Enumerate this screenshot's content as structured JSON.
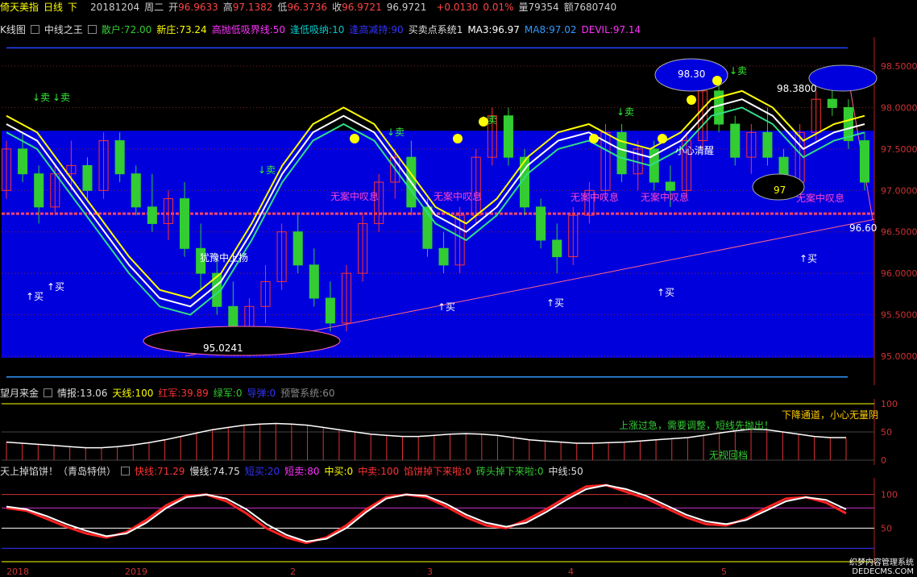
{
  "topbar": {
    "name": "倚天美指",
    "period": "日线",
    "direction": "下",
    "date": "20181204",
    "weekday": "周二",
    "open_label": "开",
    "open": "96.9633",
    "high_label": "高",
    "high": "97.1382",
    "low_label": "低",
    "low": "96.3736",
    "close_label": "收",
    "close": "96.9721",
    "last": "96.9721",
    "change": "+0.0130",
    "change_pct": "0.01%",
    "volume_label": "量",
    "volume": "79354",
    "amount_label": "额",
    "amount": "7680740"
  },
  "main_header": {
    "kline_label": "K线图",
    "indicator_name": "中线之王",
    "items": [
      {
        "text": "散户:72.00",
        "color": "#33cc33"
      },
      {
        "text": "新庄:73.24",
        "color": "#ffff00"
      },
      {
        "text": "高抛低吸界线:50",
        "color": "#ff33ff"
      },
      {
        "text": "逢低吸纳:10",
        "color": "#00cccc"
      },
      {
        "text": "逢高减持:90",
        "color": "#3333ff"
      },
      {
        "text": "买卖点系统1",
        "color": "#dddddd"
      },
      {
        "text": "MA3:96.97",
        "color": "#ffffff"
      },
      {
        "text": "MA8:97.02",
        "color": "#3399ff"
      },
      {
        "text": "DEVIL:97.14",
        "color": "#ff33ff"
      }
    ]
  },
  "ind1_header": {
    "name": "望月来金",
    "items": [
      {
        "text": "情报:13.06",
        "color": "#dddddd"
      },
      {
        "text": "天线:100",
        "color": "#ffff00"
      },
      {
        "text": "红军:39.89",
        "color": "#ff3333"
      },
      {
        "text": "绿军:0",
        "color": "#33cc33"
      },
      {
        "text": "导弹:0",
        "color": "#3333ff"
      },
      {
        "text": "预警系统:60",
        "color": "#888888"
      }
    ],
    "annotations": [
      "下降通道，小心无量阴",
      "上涨过急，需要调整，短线先抛出！",
      "无视回档"
    ]
  },
  "ind2_header": {
    "name": "天上掉馅饼！（青岛特供）",
    "items": [
      {
        "text": "快线:71.29",
        "color": "#ff3333"
      },
      {
        "text": "慢线:74.75",
        "color": "#dddddd"
      },
      {
        "text": "短买:20",
        "color": "#3333ff"
      },
      {
        "text": "短卖:80",
        "color": "#ff33ff"
      },
      {
        "text": "中买:0",
        "color": "#ffff00"
      },
      {
        "text": "中卖:100",
        "color": "#ff3333"
      },
      {
        "text": "馅饼掉下来啦:0",
        "color": "#ff3333"
      },
      {
        "text": "砖头掉下来啦:0",
        "color": "#33cc33"
      },
      {
        "text": "中线:50",
        "color": "#dddddd"
      }
    ]
  },
  "annotations": {
    "buy": "↑买",
    "sell": "↓卖",
    "buy_plain": "买",
    "sleep": "无案中叹息",
    "hesitate": "犹豫中上扬",
    "careful": "小心清醒",
    "label_9830": "98.30",
    "label_9838": "98.3800",
    "label_97": "97",
    "label_950241": "95.0241",
    "label_9660": "96.60"
  },
  "xaxis": [
    "2018",
    "2019",
    "2",
    "3",
    "4",
    "5"
  ],
  "watermark": [
    "织梦内容管理系统",
    "DEDECMS.COM"
  ],
  "colors": {
    "channel": "#0000dd",
    "up": "#ff3333",
    "down": "#33cc33",
    "ma_white": "#ffffff",
    "ma_yellow": "#ffff00"
  },
  "chart_data": [
    {
      "type": "candlestick",
      "title": "倚天美指 日线",
      "y_ticks": [
        95.0,
        95.5,
        96.0,
        96.5,
        97.0,
        97.5,
        98.0,
        98.5
      ],
      "ylim": [
        94.65,
        98.85
      ],
      "ohlc": [
        [
          97.0,
          97.6,
          96.9,
          97.5
        ],
        [
          97.5,
          97.7,
          97.1,
          97.2
        ],
        [
          97.2,
          97.3,
          96.6,
          96.8
        ],
        [
          96.8,
          97.3,
          96.7,
          97.2
        ],
        [
          97.2,
          97.6,
          97.0,
          97.3
        ],
        [
          97.3,
          97.4,
          96.9,
          97.0
        ],
        [
          97.0,
          97.7,
          96.9,
          97.6
        ],
        [
          97.6,
          97.7,
          97.1,
          97.2
        ],
        [
          97.2,
          97.3,
          96.7,
          96.8
        ],
        [
          96.8,
          97.2,
          96.5,
          96.6
        ],
        [
          96.6,
          97.0,
          96.4,
          96.9
        ],
        [
          96.9,
          97.1,
          96.2,
          96.3
        ],
        [
          96.3,
          96.6,
          95.8,
          96.0
        ],
        [
          96.0,
          96.2,
          95.5,
          95.6
        ],
        [
          95.6,
          95.9,
          95.1,
          95.2
        ],
        [
          95.2,
          95.7,
          95.0,
          95.6
        ],
        [
          95.6,
          96.1,
          95.4,
          95.9
        ],
        [
          95.9,
          96.6,
          95.8,
          96.5
        ],
        [
          96.5,
          96.7,
          96.0,
          96.1
        ],
        [
          96.1,
          96.3,
          95.6,
          95.7
        ],
        [
          95.7,
          95.9,
          95.3,
          95.4
        ],
        [
          95.4,
          96.1,
          95.3,
          96.0
        ],
        [
          96.0,
          96.7,
          95.9,
          96.6
        ],
        [
          96.6,
          97.2,
          96.5,
          97.1
        ],
        [
          97.1,
          97.5,
          96.9,
          97.4
        ],
        [
          97.4,
          97.6,
          96.7,
          96.8
        ],
        [
          96.8,
          96.9,
          96.2,
          96.3
        ],
        [
          96.3,
          96.5,
          96.0,
          96.1
        ],
        [
          96.1,
          96.8,
          96.0,
          96.7
        ],
        [
          96.7,
          97.5,
          96.6,
          97.4
        ],
        [
          97.4,
          98.0,
          97.3,
          97.9
        ],
        [
          97.9,
          98.0,
          97.3,
          97.4
        ],
        [
          97.4,
          97.5,
          96.7,
          96.8
        ],
        [
          96.8,
          96.9,
          96.3,
          96.4
        ],
        [
          96.4,
          96.6,
          96.0,
          96.2
        ],
        [
          96.2,
          96.8,
          96.1,
          96.7
        ],
        [
          96.7,
          97.1,
          96.6,
          97.0
        ],
        [
          97.0,
          97.8,
          96.9,
          97.7
        ],
        [
          97.7,
          97.8,
          97.1,
          97.2
        ],
        [
          97.2,
          97.6,
          97.0,
          97.5
        ],
        [
          97.5,
          97.6,
          97.0,
          97.1
        ],
        [
          97.1,
          97.3,
          96.8,
          97.0
        ],
        [
          97.0,
          97.7,
          96.9,
          97.6
        ],
        [
          97.6,
          98.4,
          97.5,
          98.2
        ],
        [
          98.2,
          98.4,
          97.7,
          97.8
        ],
        [
          97.8,
          97.9,
          97.3,
          97.4
        ],
        [
          97.4,
          97.8,
          97.2,
          97.7
        ],
        [
          97.7,
          98.0,
          97.3,
          97.4
        ],
        [
          97.4,
          97.5,
          97.0,
          97.1
        ],
        [
          97.1,
          97.8,
          97.0,
          97.7
        ],
        [
          97.7,
          98.2,
          97.6,
          98.1
        ],
        [
          98.1,
          98.4,
          97.9,
          98.0
        ],
        [
          98.0,
          98.1,
          97.5,
          97.6
        ],
        [
          97.6,
          97.7,
          97.0,
          97.1
        ]
      ],
      "ma_white": [
        97.8,
        97.6,
        97.1,
        96.6,
        96.1,
        95.7,
        95.6,
        95.9,
        96.5,
        97.2,
        97.7,
        97.9,
        97.7,
        97.2,
        96.7,
        96.5,
        96.8,
        97.3,
        97.6,
        97.7,
        97.5,
        97.4,
        97.6,
        98.0,
        98.1,
        97.9,
        97.5,
        97.7,
        97.8
      ],
      "ma_yellow": [
        97.9,
        97.7,
        97.2,
        96.7,
        96.2,
        95.8,
        95.7,
        96.0,
        96.6,
        97.3,
        97.8,
        98.0,
        97.8,
        97.3,
        96.8,
        96.6,
        96.9,
        97.4,
        97.7,
        97.8,
        97.6,
        97.5,
        97.7,
        98.1,
        98.2,
        98.0,
        97.6,
        97.8,
        97.9
      ],
      "ma_green": [
        97.7,
        97.5,
        97.0,
        96.5,
        96.0,
        95.6,
        95.5,
        95.8,
        96.4,
        97.1,
        97.6,
        97.8,
        97.6,
        97.1,
        96.6,
        96.4,
        96.7,
        97.2,
        97.5,
        97.6,
        97.4,
        97.3,
        97.5,
        97.9,
        98.0,
        97.8,
        97.4,
        97.6,
        97.7
      ]
    },
    {
      "type": "bar",
      "title": "望月来金",
      "y_ticks": [
        0,
        50,
        100
      ],
      "ylim": [
        0,
        100
      ],
      "values": [
        32,
        30,
        28,
        26,
        24,
        22,
        22,
        24,
        27,
        31,
        36,
        42,
        48,
        54,
        58,
        62,
        64,
        65,
        64,
        62,
        58,
        54,
        50,
        46,
        44,
        42,
        42,
        44,
        46,
        47,
        46,
        44,
        40,
        36,
        34,
        32,
        30,
        30,
        31,
        32,
        34,
        36,
        38,
        40,
        44,
        48,
        52,
        55,
        54,
        50,
        46,
        42,
        40,
        40
      ]
    },
    {
      "type": "line",
      "title": "天上掉馅饼！（青岛特供）",
      "y_ticks": [
        50,
        100
      ],
      "ylim": [
        0,
        120
      ],
      "series": [
        {
          "name": "快线",
          "values": [
            80,
            76,
            64,
            52,
            42,
            36,
            44,
            62,
            84,
            98,
            100,
            90,
            72,
            50,
            36,
            28,
            36,
            54,
            78,
            96,
            100,
            96,
            82,
            66,
            54,
            50,
            62,
            78,
            96,
            112,
            114,
            104,
            94,
            80,
            66,
            56,
            54,
            64,
            80,
            94,
            96,
            88,
            72
          ]
        },
        {
          "name": "慢线",
          "values": [
            82,
            78,
            68,
            56,
            46,
            38,
            42,
            58,
            80,
            96,
            100,
            94,
            78,
            56,
            40,
            30,
            34,
            50,
            74,
            94,
            100,
            98,
            86,
            70,
            58,
            52,
            58,
            74,
            92,
            108,
            114,
            108,
            98,
            84,
            70,
            60,
            56,
            62,
            76,
            90,
            96,
            92,
            78
          ]
        }
      ]
    }
  ]
}
